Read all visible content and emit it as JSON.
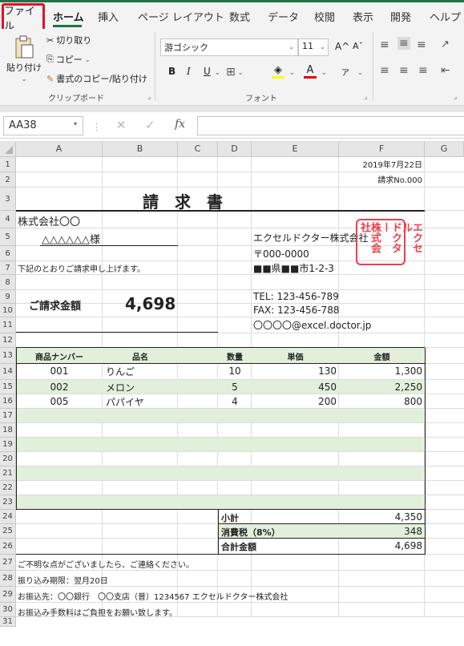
{
  "ribbon": {
    "tabs": {
      "file": "ファイル",
      "home": "ホーム",
      "insert": "挿入",
      "page_layout": "ページ レイアウト",
      "formulas": "数式",
      "data": "データ",
      "review": "校閲",
      "view": "表示",
      "developer": "開発",
      "help": "ヘルプ"
    },
    "clipboard": {
      "paste": "貼り付け",
      "cut": "切り取り",
      "copy": "コピー",
      "format_painter": "書式のコピー/貼り付け",
      "group_label": "クリップボード"
    },
    "font": {
      "name": "游ゴシック",
      "size": "11",
      "bold": "B",
      "italic": "I",
      "underline": "U",
      "font_color_letter": "A",
      "grow": "A^",
      "shrink": "Aˇ",
      "phonetic": "ア",
      "group_label": "フォント",
      "highlight_color": "#ffff00",
      "font_color": "#e00000"
    }
  },
  "formula_bar": {
    "name_box": "AA38",
    "fx": "fx"
  },
  "columns": [
    "A",
    "B",
    "C",
    "D",
    "E",
    "F",
    "G"
  ],
  "rows": [
    "1",
    "2",
    "3",
    "4",
    "5",
    "6",
    "7",
    "8",
    "9",
    "10",
    "11",
    "12",
    "13",
    "14",
    "15",
    "16",
    "17",
    "18",
    "19",
    "20",
    "21",
    "22",
    "23",
    "24",
    "25",
    "26",
    "27",
    "28",
    "29",
    "30",
    "31"
  ],
  "invoice": {
    "date": "2019年7月22日",
    "number": "請求No.000",
    "title": "請　求　書",
    "client_company": "株式会社〇〇",
    "client_person": "△△△△△△様",
    "issuer": "エクセルドクター株式会社",
    "postal": "〒000-0000",
    "address": "■■県■■市1-2-3",
    "greeting": "下記のとおりご請求申し上げます。",
    "tel": "TEL: 123-456-789",
    "fax": "FAX: 123-456-788",
    "email": "〇〇〇〇@excel.doctor.jp",
    "amount_label": "ご請求金額",
    "amount_value": "4,698",
    "seal": [
      "エクセル",
      "ドクター",
      "株式会社"
    ],
    "headers": {
      "product_no": "商品ナンバー",
      "item": "品名",
      "qty": "数量",
      "unit_price": "単価",
      "amount": "金額"
    },
    "items": [
      {
        "no": "001",
        "name": "りんご",
        "qty": "10",
        "price": "130",
        "amount": "1,300"
      },
      {
        "no": "002",
        "name": "メロン",
        "qty": "5",
        "price": "450",
        "amount": "2,250"
      },
      {
        "no": "005",
        "name": "パパイヤ",
        "qty": "4",
        "price": "200",
        "amount": "800"
      }
    ],
    "subtotal_label": "小計",
    "subtotal": "4,350",
    "tax_label": "消費税（8%）",
    "tax": "348",
    "total_label": "合計金額",
    "total": "4,698",
    "note1": "ご不明な点がございましたら、ご連絡ください。",
    "note2": "振り込み期限：翌月20日",
    "note3": "お振込先：〇〇銀行　〇〇支店（普）1234567 エクセルドクター株式会社",
    "note4": "お振込み手数料はご負担をお願い致します。",
    "seal_color": "#e8414b"
  }
}
